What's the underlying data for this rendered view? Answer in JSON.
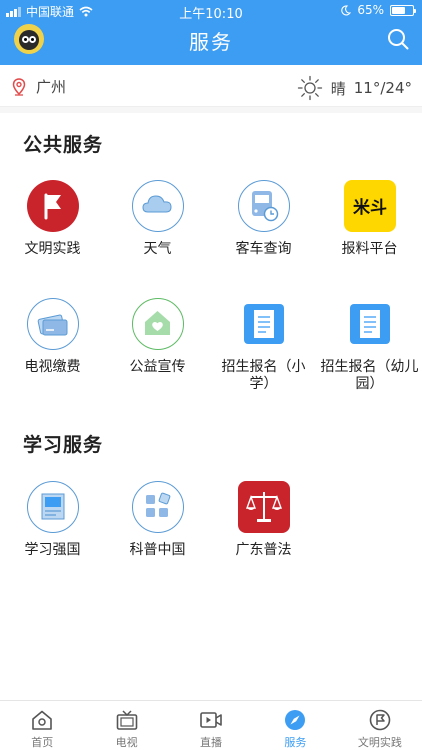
{
  "status_bar": {
    "carrier": "中国联通",
    "time": "上午10:10",
    "battery": "65%",
    "battery_level": 0.65
  },
  "header": {
    "title": "服务"
  },
  "location": {
    "city": "广州",
    "weather": "晴",
    "temperature": "11°/24°"
  },
  "sections": [
    {
      "title": "公共服务",
      "items": [
        {
          "label": "文明实践",
          "icon": "red-flag-icon"
        },
        {
          "label": "天气",
          "icon": "cloud-icon"
        },
        {
          "label": "客车查询",
          "icon": "bus-clock-icon"
        },
        {
          "label": "报料平台",
          "icon": "news-tip-icon"
        },
        {
          "label": "电视缴费",
          "icon": "card-payment-icon"
        },
        {
          "label": "公益宣传",
          "icon": "heart-house-icon"
        },
        {
          "label": "招生报名（小学）",
          "icon": "notebook-icon"
        },
        {
          "label": "招生报名（幼儿园）",
          "icon": "notebook-icon"
        }
      ]
    },
    {
      "title": "学习服务",
      "items": [
        {
          "label": "学习强国",
          "icon": "study-flag-icon"
        },
        {
          "label": "科普中国",
          "icon": "science-blocks-icon"
        },
        {
          "label": "广东普法",
          "icon": "justice-scale-icon"
        }
      ]
    }
  ],
  "tabbar": {
    "tabs": [
      {
        "label": "首页",
        "icon": "home-icon"
      },
      {
        "label": "电视",
        "icon": "tv-icon"
      },
      {
        "label": "直播",
        "icon": "live-video-icon"
      },
      {
        "label": "服务",
        "icon": "compass-icon",
        "active": true
      },
      {
        "label": "文明实践",
        "icon": "flag-circle-icon"
      }
    ]
  },
  "colors": {
    "brand_blue": "#3d9df3",
    "icon_outline_blue": "#5b9bd5",
    "red": "#c9242b",
    "yellow": "#ffd700",
    "green": "#5dbb63"
  }
}
